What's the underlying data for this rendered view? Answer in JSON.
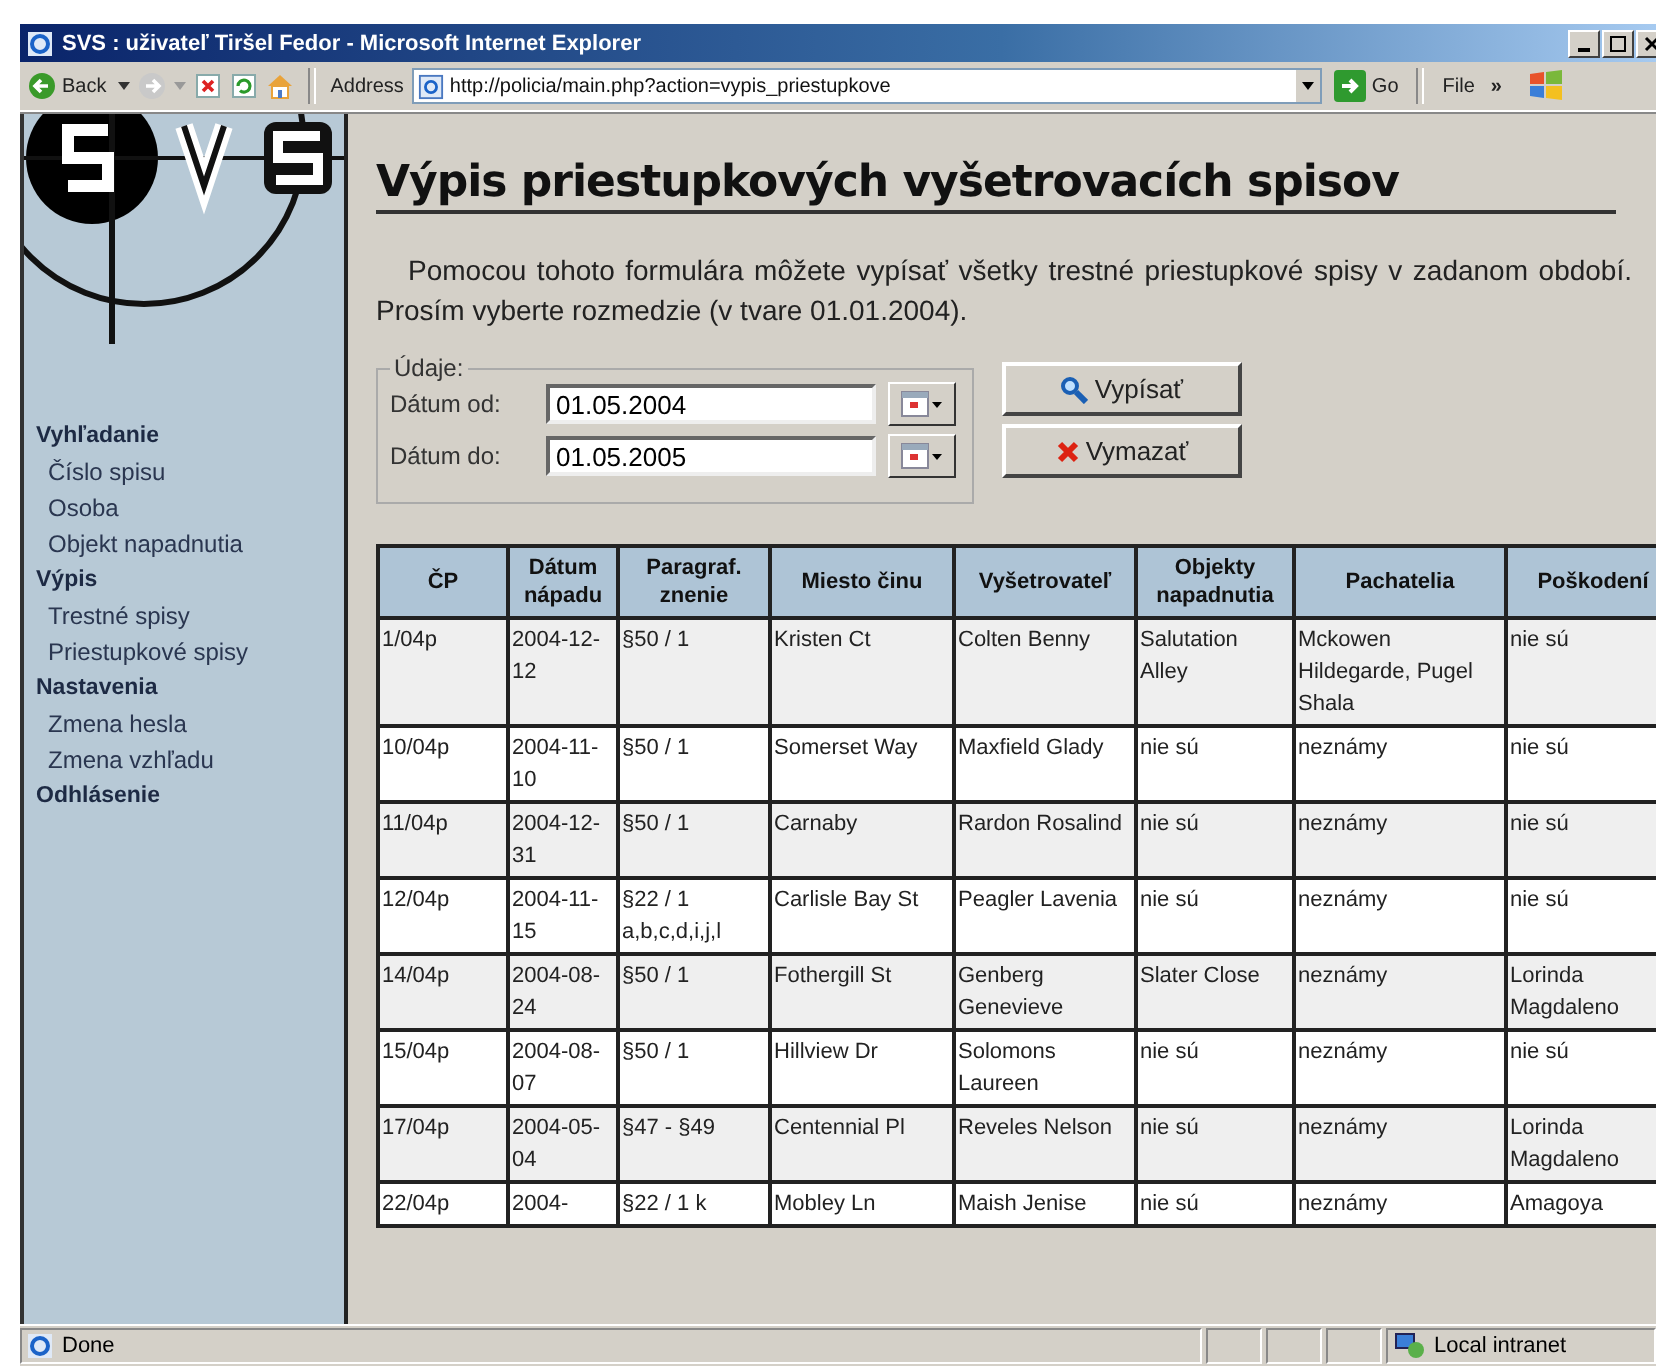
{
  "window": {
    "title": "SVS : uživateľ Tiršel Fedor - Microsoft Internet Explorer"
  },
  "toolbar": {
    "back": "Back",
    "address_label": "Address",
    "url": "http://policia/main.php?action=vypis_priestupkove",
    "go": "Go",
    "menu": "File",
    "more": "»"
  },
  "sidebar": {
    "sections": [
      {
        "title": "Vyhľadanie",
        "items": [
          "Číslo spisu",
          "Osoba",
          "Objekt napadnutia"
        ]
      },
      {
        "title": "Výpis",
        "items": [
          "Trestné spisy",
          "Priestupkové spisy"
        ]
      },
      {
        "title": "Nastavenia",
        "items": [
          "Zmena hesla",
          "Zmena vzhľadu"
        ]
      },
      {
        "title": "Odhlásenie"
      }
    ]
  },
  "page": {
    "title": "Výpis priestupkových vyšetrovacích spisov",
    "intro": "Pomocou tohoto formulára môžete vypísať všetky trestné priestupkové spisy v zadanom období. Prosím vyberte rozmedzie (v tvare 01.01.2004)."
  },
  "form": {
    "legend": "Údaje:",
    "fields": [
      {
        "label": "Dátum od:",
        "value": "01.05.2004"
      },
      {
        "label": "Dátum do:",
        "value": "01.05.2005"
      }
    ],
    "buttons": [
      {
        "kind": "search",
        "label": "Vypísať"
      },
      {
        "kind": "clear",
        "label": "Vymazať"
      }
    ]
  },
  "table": {
    "columns": [
      "ČP",
      "Dátum nápadu",
      "Paragraf. znenie",
      "Miesto činu",
      "Vyšetrovateľ",
      "Objekty napadnutia",
      "Pachatelia",
      "Poškodení"
    ],
    "rows": [
      [
        "1/04p",
        "2004-12-12",
        "§50 / 1",
        "Kristen Ct",
        "Colten Benny",
        "Salutation Alley",
        "Mckowen Hildegarde, Pugel Shala",
        "nie sú"
      ],
      [
        "10/04p",
        "2004-11-10",
        "§50 / 1",
        "Somerset Way",
        "Maxfield Glady",
        "nie sú",
        "neznámy",
        "nie sú"
      ],
      [
        "11/04p",
        "2004-12-31",
        "§50 / 1",
        "Carnaby",
        "Rardon Rosalind",
        "nie sú",
        "neznámy",
        "nie sú"
      ],
      [
        "12/04p",
        "2004-11-15",
        "§22 / 1 a,b,c,d,i,j,l",
        "Carlisle Bay St",
        "Peagler Lavenia",
        "nie sú",
        "neznámy",
        "nie sú"
      ],
      [
        "14/04p",
        "2004-08-24",
        "§50 / 1",
        "Fothergill St",
        "Genberg Genevieve",
        "Slater Close",
        "neznámy",
        "Lorinda Magdaleno"
      ],
      [
        "15/04p",
        "2004-08-07",
        "§50 / 1",
        "Hillview Dr",
        "Solomons Laureen",
        "nie sú",
        "neznámy",
        "nie sú"
      ],
      [
        "17/04p",
        "2004-05-04",
        "§47 - §49",
        "Centennial Pl",
        "Reveles Nelson",
        "nie sú",
        "neznámy",
        "Lorinda Magdaleno"
      ],
      [
        "22/04p",
        "2004-",
        "§22 / 1 k",
        "Mobley Ln",
        "Maish Jenise",
        "nie sú",
        "neznámy",
        "Amagoya"
      ]
    ]
  },
  "status_bar": {
    "text": "Done",
    "zone": "Local intranet"
  }
}
